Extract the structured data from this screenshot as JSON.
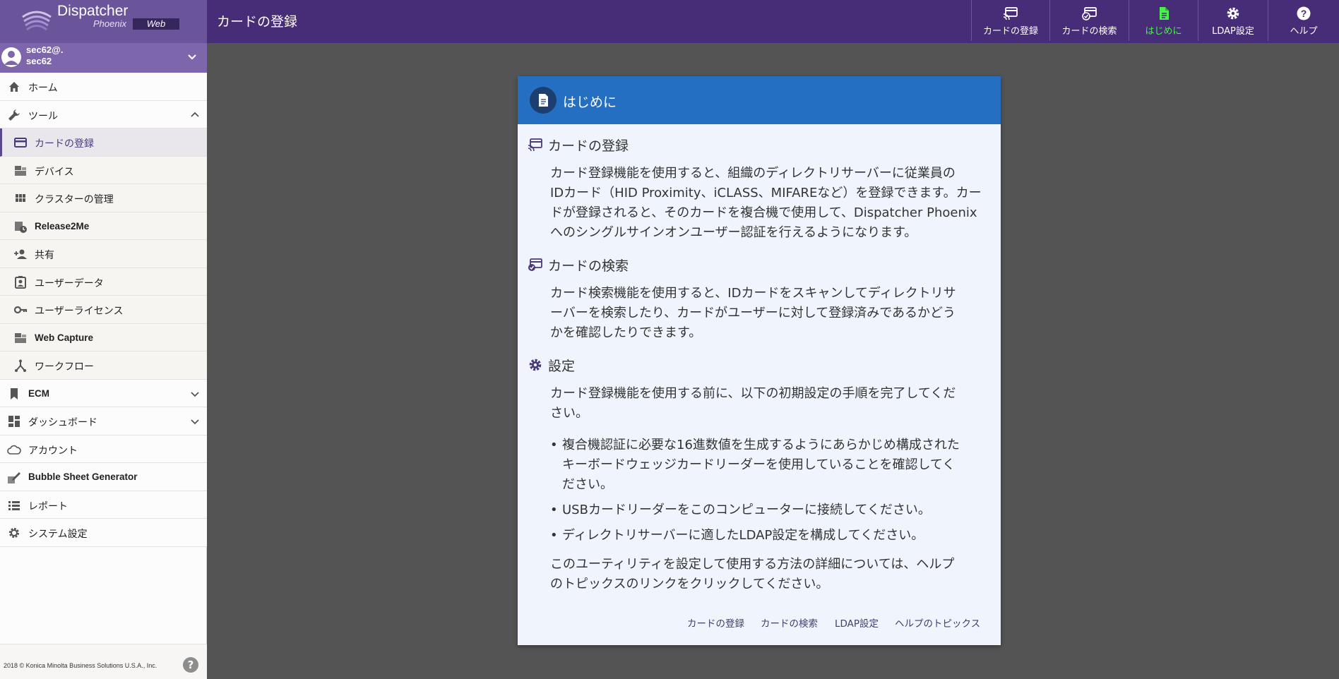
{
  "app": {
    "name": "Dispatcher",
    "subtitle": "Phoenix",
    "badge": "Web",
    "page_title": "カードの登録"
  },
  "user": {
    "line1": "sec62@.",
    "line2": "sec62"
  },
  "sidebar": {
    "items": [
      {
        "label": "ホーム",
        "icon": "home-icon"
      },
      {
        "label": "ツール",
        "icon": "wrench-icon",
        "expanded": true
      },
      {
        "label": "カードの登録",
        "icon": "card-icon",
        "active": true
      },
      {
        "label": "デバイス",
        "icon": "devices-icon"
      },
      {
        "label": "クラスターの管理",
        "icon": "grid-icon"
      },
      {
        "label": "Release2Me",
        "icon": "release-icon"
      },
      {
        "label": "共有",
        "icon": "add-person-icon"
      },
      {
        "label": "ユーザーデータ",
        "icon": "contact-badge-icon"
      },
      {
        "label": "ユーザーライセンス",
        "icon": "key-icon"
      },
      {
        "label": "Web Capture",
        "icon": "web-capture-icon"
      },
      {
        "label": "ワークフロー",
        "icon": "workflow-icon"
      },
      {
        "label": "ECM",
        "icon": "bookmark-icon"
      },
      {
        "label": "ダッシュボード",
        "icon": "dashboard-icon"
      },
      {
        "label": "アカウント",
        "icon": "cloud-icon"
      },
      {
        "label": "Bubble Sheet Generator",
        "icon": "pencil-sheet-icon"
      },
      {
        "label": "レポート",
        "icon": "list-icon"
      },
      {
        "label": "システム設定",
        "icon": "gear-icon"
      }
    ]
  },
  "footer": {
    "copyright": "2018 © Konica Minolta Business Solutions U.S.A., Inc.",
    "help_icon": "help-icon"
  },
  "topnav": {
    "items": [
      {
        "label": "カードの登録",
        "icon": "card-register-icon"
      },
      {
        "label": "カードの検索",
        "icon": "card-search-icon"
      },
      {
        "label": "はじめに",
        "icon": "document-icon",
        "current": true
      },
      {
        "label": "LDAP設定",
        "icon": "gear-icon"
      },
      {
        "label": "ヘルプ",
        "icon": "help-icon"
      }
    ]
  },
  "modal": {
    "title": "はじめに",
    "sections": [
      {
        "title": "カードの登録",
        "icon": "card-register-icon",
        "lines": [
          "カード登録機能を使用すると、組織のディレクトリサーバーに従業員の",
          "IDカード（HID Proximity、iCLASS、MIFAREなど）を登録できます。カー",
          "ドが登録されると、そのカードを複合機で使用して、Dispatcher Phoenix",
          "へのシングルサインオンユーザー認証を行えるようになります。"
        ]
      },
      {
        "title": "カードの検索",
        "icon": "card-search-icon",
        "lines": [
          "カード検索機能を使用すると、IDカードをスキャンしてディレクトリサ",
          "ーバーを検索したり、カードがユーザーに対して登録済みであるかどう",
          "かを確認したりできます。"
        ]
      },
      {
        "title": "設定",
        "icon": "gear-icon",
        "lines": [
          "カード登録機能を使用する前に、以下の初期設定の手順を完了してくだ",
          "さい。"
        ],
        "bullets": [
          [
            "複合機認証に必要な16進数値を生成するようにあらかじめ構成された",
            "キーボードウェッジカードリーダーを使用していることを確認してく",
            "ださい。"
          ],
          [
            "USBカードリーダーをこのコンピューターに接続してください。"
          ],
          [
            "ディレクトリサーバーに適したLDAP設定を構成してください。"
          ]
        ],
        "closing": [
          "このユーティリティを設定して使用する方法の詳細については、ヘルプ",
          "のトピックスのリンクをクリックしてください。"
        ]
      }
    ],
    "footer_links": [
      "カードの登録",
      "カードの検索",
      "LDAP設定",
      "ヘルプのトピックス"
    ]
  },
  "colors": {
    "topbar": "#472c78",
    "brand": "#6a559a",
    "modal_header": "#246fc1",
    "current_tab": "#4cf04c"
  }
}
